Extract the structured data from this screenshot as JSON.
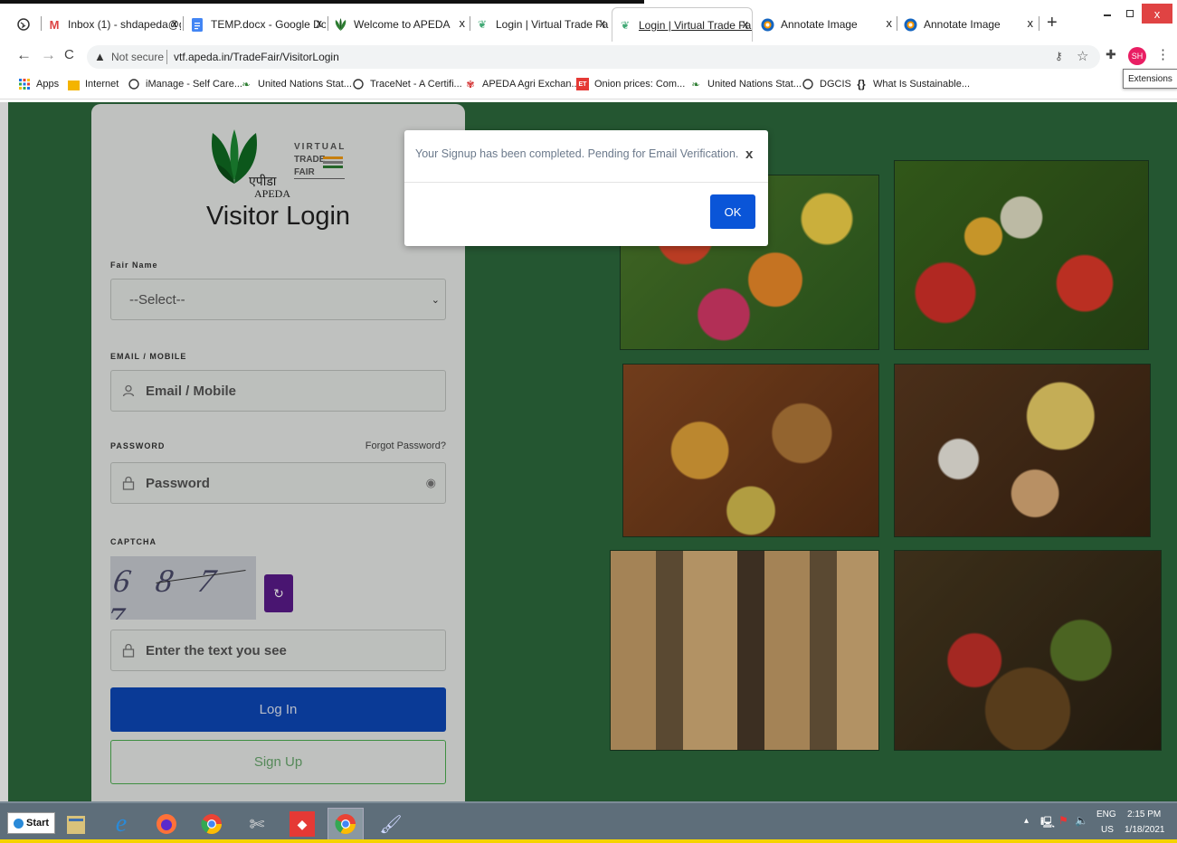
{
  "browser": {
    "tabs": [
      {
        "label": "",
        "icon": "globe-icon"
      },
      {
        "label": "Inbox (1) - shdapeda@g",
        "icon": "gmail-icon"
      },
      {
        "label": "TEMP.docx - Google Do",
        "icon": "docs-icon"
      },
      {
        "label": "Welcome to APEDA",
        "icon": "apeda-icon"
      },
      {
        "label": "Login | Virtual Trade Fair",
        "icon": "vtf-icon"
      },
      {
        "label": "Login | Virtual Trade Fair",
        "icon": "vtf-icon"
      },
      {
        "label": "Annotate Image",
        "icon": "annotate-icon"
      },
      {
        "label": "Annotate Image",
        "icon": "annotate-icon"
      }
    ],
    "close_glyph": "x",
    "new_tab": "+",
    "security_label": "Not secure",
    "url": "vtf.apeda.in/TradeFair/VisitorLogin",
    "profile_initials": "SH",
    "extensions_tooltip": "Extensions",
    "bookmarks": [
      {
        "label": "Apps"
      },
      {
        "label": "Internet"
      },
      {
        "label": "iManage - Self Care..."
      },
      {
        "label": "United Nations Stat..."
      },
      {
        "label": "TraceNet - A Certifi..."
      },
      {
        "label": "APEDA Agri Exchan..."
      },
      {
        "label": "Onion prices: Com..."
      },
      {
        "label": "United Nations Stat..."
      },
      {
        "label": "DGCIS"
      },
      {
        "label": "What Is Sustainable..."
      }
    ]
  },
  "login": {
    "logo_virtual": "VIRTUAL",
    "logo_trade": "TRADE",
    "logo_fair": "FAIR",
    "logo_hindi": "एपीडा",
    "logo_apeda": "APEDA",
    "title": "Visitor Login",
    "fair_label": "Fair Name",
    "fair_value": "--Select--",
    "email_label": "EMAIL / MOBILE",
    "email_placeholder": "Email / Mobile",
    "password_label": "PASSWORD",
    "forgot_password": "Forgot Password?",
    "password_placeholder": "Password",
    "captcha_label": "CAPTCHA",
    "captcha_text": "6 8 7 7",
    "captcha_placeholder": "Enter the text you see",
    "login_button": "Log In",
    "signup_button": "Sign Up"
  },
  "modal": {
    "message": "Your Signup has been completed. Pending for Email Verification.",
    "close_glyph": "x",
    "ok_button": "OK"
  },
  "taskbar": {
    "start_label": "Start",
    "lang": "ENG",
    "region": "US",
    "time": "2:15 PM",
    "date": "1/18/2021"
  },
  "colors": {
    "page_green": "#2c6a3c",
    "primary_blue": "#0d47b8",
    "ok_blue": "#0a55d8",
    "refresh_purple": "#5a1a8a"
  }
}
